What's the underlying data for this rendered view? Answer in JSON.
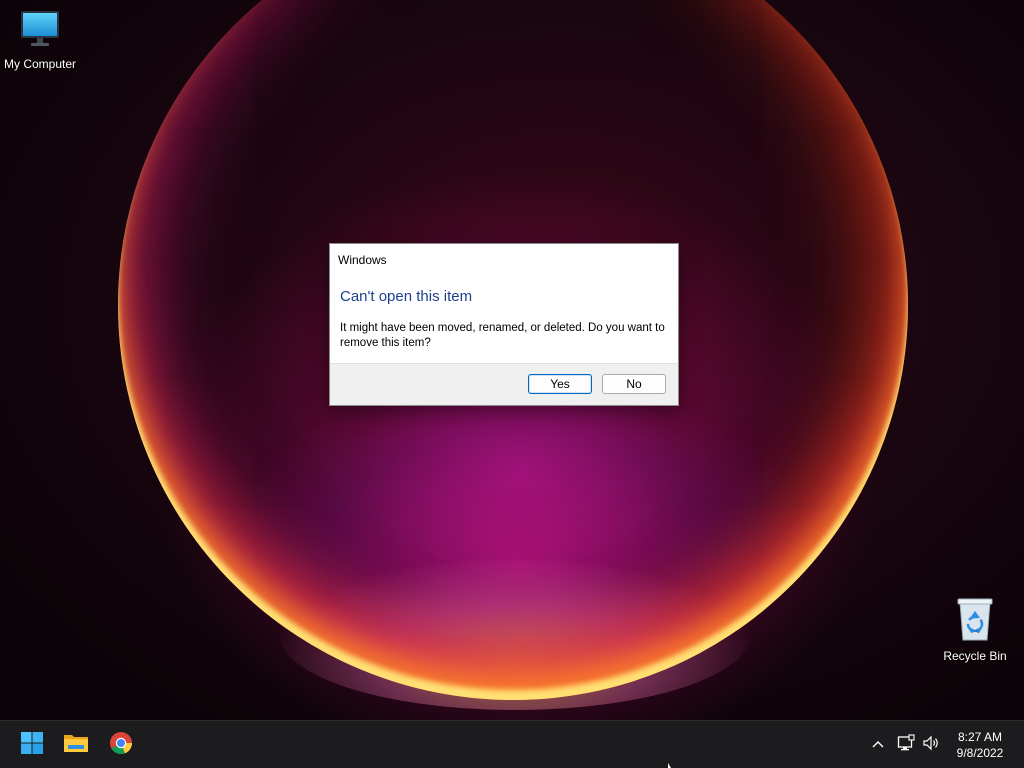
{
  "desktop": {
    "icons": [
      {
        "label": "My Computer",
        "icon": "monitor-icon"
      },
      {
        "label": "Recycle Bin",
        "icon": "recycle-bin-icon"
      }
    ]
  },
  "dialog": {
    "title": "Windows",
    "heading": "Can't open this item",
    "message": "It might have been moved, renamed, or deleted. Do you want to remove this item?",
    "yes_label": "Yes",
    "no_label": "No",
    "heading_color": "#1e3f8a"
  },
  "taskbar": {
    "pinned": [
      {
        "name": "Start",
        "icon": "windows-logo-icon"
      },
      {
        "name": "File Explorer",
        "icon": "folder-icon"
      },
      {
        "name": "Google Chrome",
        "icon": "chrome-icon"
      }
    ],
    "tray": {
      "icons": [
        "chevron-up-icon",
        "network-icon",
        "volume-icon"
      ]
    },
    "clock": {
      "time": "8:27 AM",
      "date": "9/8/2022"
    }
  },
  "colors": {
    "taskbar_bg": "#1c1c1e",
    "accent": "#0067c0"
  }
}
